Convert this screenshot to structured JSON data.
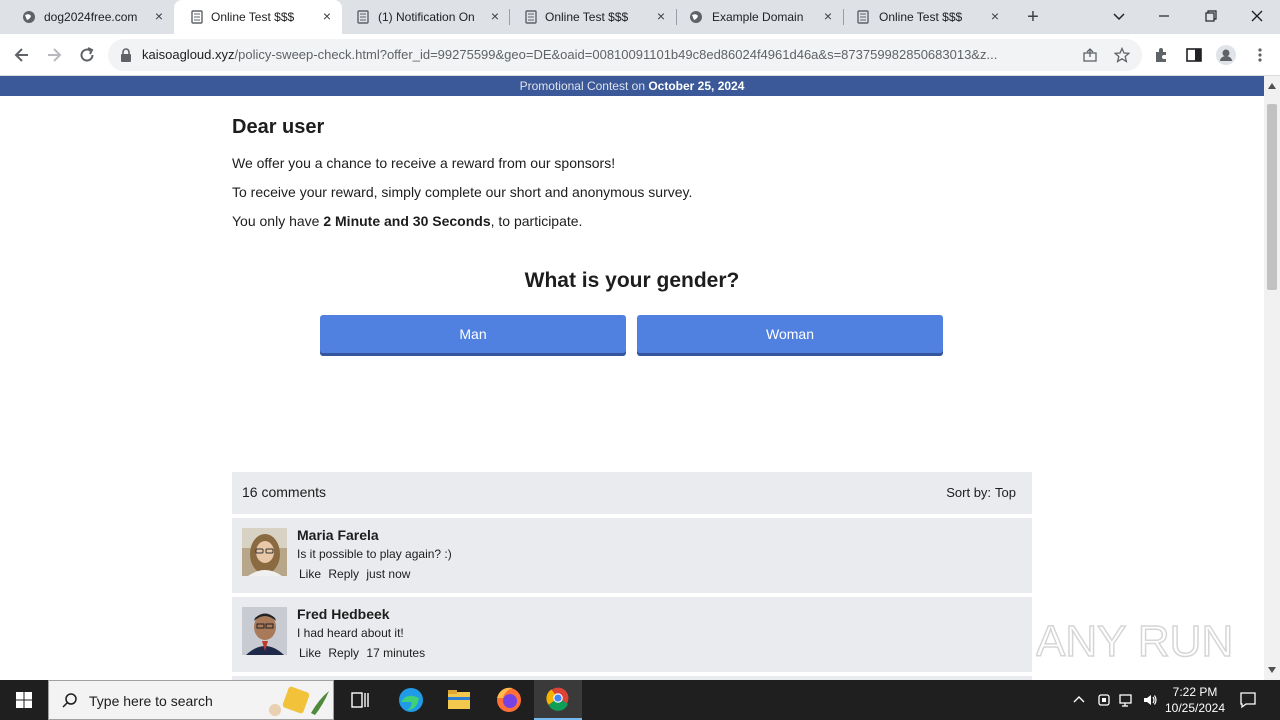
{
  "browser": {
    "tabs": [
      {
        "title": "dog2024free.com",
        "icon": "globe-icon",
        "active": false
      },
      {
        "title": "Online Test $$$",
        "icon": "document-icon",
        "active": true
      },
      {
        "title": "(1) Notification On",
        "icon": "document-icon",
        "active": false
      },
      {
        "title": "Online Test $$$",
        "icon": "document-icon",
        "active": false
      },
      {
        "title": "Example Domain",
        "icon": "globe-icon",
        "active": false
      },
      {
        "title": "Online Test $$$",
        "icon": "document-icon",
        "active": false
      }
    ],
    "url_host": "kaisoagloud.xyz",
    "url_path": "/policy-sweep-check.html?offer_id=99275599&geo=DE&oaid=00810091101b49c8ed86024f4961d46a&s=873759982850683013&z..."
  },
  "page": {
    "promo_prefix": "Promotional Contest on ",
    "promo_date": "October 25, 2024",
    "greeting": "Dear user",
    "line1": "We offer you a chance to receive a reward from our sponsors!",
    "line2": "To receive your reward, simply complete our short and anonymous survey.",
    "line3_prefix": "You only have ",
    "line3_bold": "2 Minute and 30 Seconds",
    "line3_suffix": ", to participate.",
    "question": "What is your gender?",
    "option_man": "Man",
    "option_woman": "Woman"
  },
  "comments": {
    "count_label": "16 comments",
    "sort_label": "Sort by:",
    "sort_value": "Top",
    "items": [
      {
        "author": "Maria Farela",
        "text": "Is it possible to play again? :)",
        "like": "Like",
        "reply": "Reply",
        "time": "just now"
      },
      {
        "author": "Fred Hedbeek",
        "text": "I had heard about it!",
        "like": "Like",
        "reply": "Reply",
        "time": "17 minutes"
      }
    ]
  },
  "watermark": {
    "text": "ANY RUN"
  },
  "taskbar": {
    "search_placeholder": "Type here to search",
    "time": "7:22 PM",
    "date": "10/25/2024"
  },
  "colors": {
    "promo_bar": "#3b5998",
    "button": "#5181e0",
    "comment_bg": "#e9ebee"
  }
}
